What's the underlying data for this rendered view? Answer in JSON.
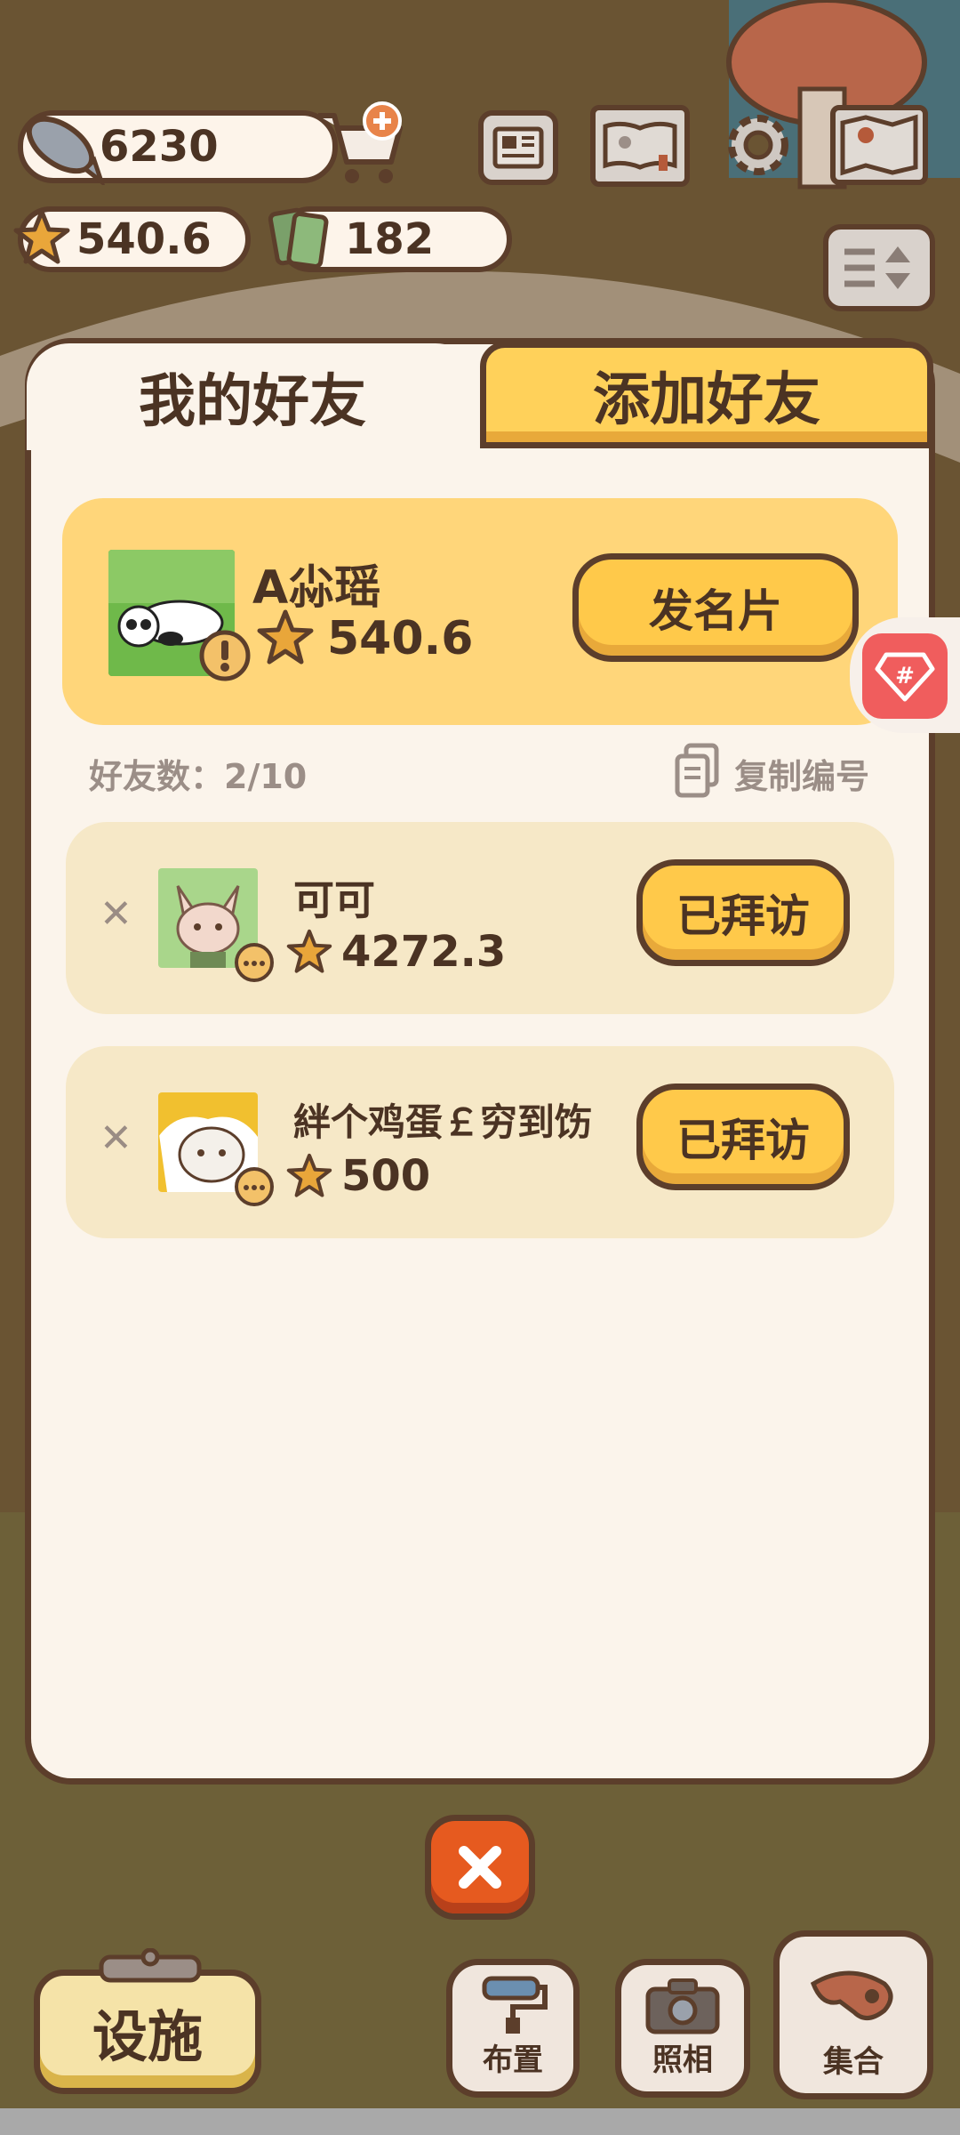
{
  "currency": {
    "fish": "6230",
    "stars": "540.6",
    "tickets": "182"
  },
  "tabs": {
    "my_friends": "我的好友",
    "add_friends": "添加好友"
  },
  "my_card": {
    "name": "A尛瑶",
    "score": "540.6",
    "send_card_label": "发名片"
  },
  "friends_meta": {
    "count_label": "好友数：2/10",
    "copy_id_label": "复制编号"
  },
  "friends": [
    {
      "name": "可可",
      "score": "4272.3",
      "action": "已拜访"
    },
    {
      "name": "絆个鸡蛋￡穷到饬",
      "score": "500",
      "action": "已拜访"
    }
  ],
  "bottom_bar": {
    "facilities": "设施",
    "arrange": "布置",
    "photo": "照相",
    "gather": "集合"
  },
  "side_badge": "#",
  "colors": {
    "panel": "#fbf4eb",
    "accent_yellow": "#ffc94a",
    "outline": "#5c3e2b",
    "close_orange": "#e65a1f"
  }
}
